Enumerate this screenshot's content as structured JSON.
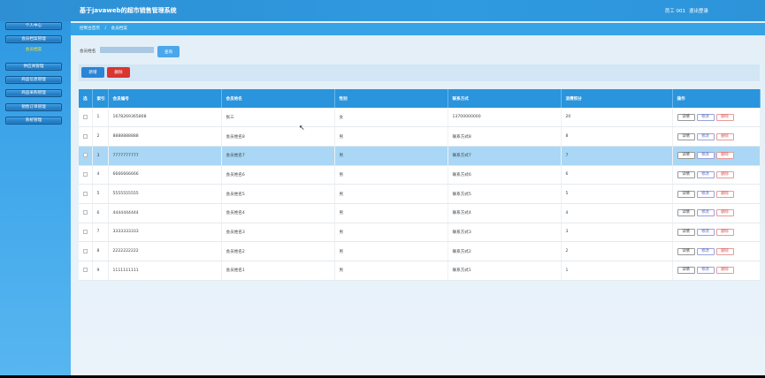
{
  "header": {
    "title": "基于javaweb的超市销售管理系统",
    "user": "员工 001",
    "logout": "退出登录"
  },
  "sidebar": {
    "items": [
      {
        "label": "系统首页"
      },
      {
        "label": "个人中心"
      },
      {
        "label": "会员档案管理"
      },
      {
        "label": "会员档案"
      },
      {
        "label": "供应商管理"
      },
      {
        "label": "商品信息管理"
      },
      {
        "label": "商品采购管理"
      },
      {
        "label": "销售订单管理"
      },
      {
        "label": "系统管理"
      }
    ]
  },
  "breadcrumb": {
    "home": "控制台首页",
    "separator": "/",
    "current": "会员档案"
  },
  "search": {
    "label": "会员姓名",
    "value": "",
    "button": "查询"
  },
  "actions": {
    "add": "新增",
    "delete": "删除"
  },
  "table": {
    "headers": [
      "",
      "索引",
      "会员编号",
      "会员姓名",
      "性别",
      "联系方式",
      "消费积分",
      "操作"
    ],
    "header_checkbox": "选",
    "rows": [
      {
        "index": "1",
        "member_no": "1678269365808",
        "name": "张三",
        "gender": "女",
        "contact": "13700000000",
        "points": "20"
      },
      {
        "index": "2",
        "member_no": "8888888888",
        "name": "会员姓名8",
        "gender": "男",
        "contact": "联系方式8",
        "points": "8"
      },
      {
        "index": "3",
        "member_no": "7777777777",
        "name": "会员姓名7",
        "gender": "男",
        "contact": "联系方式7",
        "points": "7"
      },
      {
        "index": "4",
        "member_no": "6666666666",
        "name": "会员姓名6",
        "gender": "男",
        "contact": "联系方式6",
        "points": "6"
      },
      {
        "index": "5",
        "member_no": "5555555555",
        "name": "会员姓名5",
        "gender": "男",
        "contact": "联系方式5",
        "points": "5"
      },
      {
        "index": "6",
        "member_no": "4444444444",
        "name": "会员姓名4",
        "gender": "男",
        "contact": "联系方式4",
        "points": "4"
      },
      {
        "index": "7",
        "member_no": "3333333333",
        "name": "会员姓名3",
        "gender": "男",
        "contact": "联系方式3",
        "points": "3"
      },
      {
        "index": "8",
        "member_no": "2222222222",
        "name": "会员姓名2",
        "gender": "男",
        "contact": "联系方式2",
        "points": "2"
      },
      {
        "index": "9",
        "member_no": "1111111111",
        "name": "会员姓名1",
        "gender": "男",
        "contact": "联系方式1",
        "points": "1"
      }
    ],
    "op_labels": {
      "detail": "详情",
      "edit": "修改",
      "delete": "删除"
    }
  },
  "colors": {
    "header": "#2e8fd4",
    "breadcrumb": "#35a3e6",
    "add_button": "#2b84d4",
    "delete_button": "#d8362f",
    "selected_row": "#a9d7f5"
  }
}
